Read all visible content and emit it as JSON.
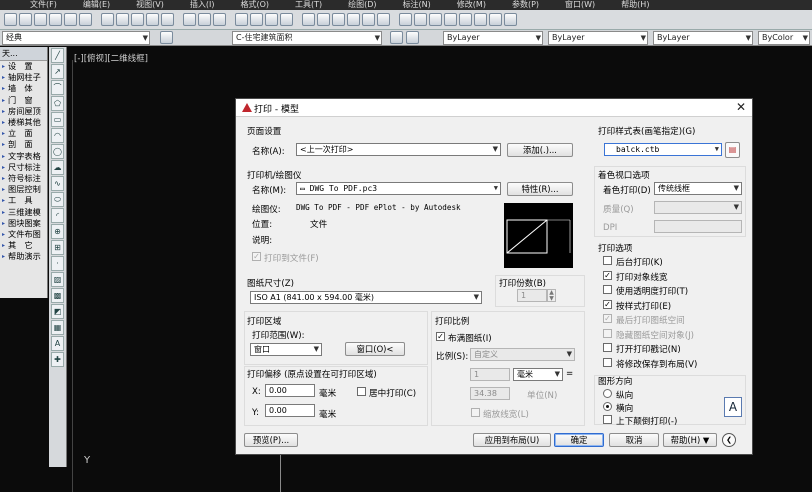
{
  "menubar": [
    "文件(F)",
    "编辑(E)",
    "视图(V)",
    "插入(I)",
    "格式(O)",
    "工具(T)",
    "绘图(D)",
    "标注(N)",
    "修改(M)",
    "参数(P)",
    "窗口(W)",
    "帮助(H)"
  ],
  "toolbar2": {
    "workspace": "经典",
    "layer": "C-住宅建筑面积",
    "color": "ByLayer",
    "linetype": "ByLayer",
    "lineweight": "ByLayer",
    "plotstyle": "ByColor"
  },
  "palette": {
    "header": "天...",
    "items": [
      "设　置",
      "轴网柱子",
      "墙　体",
      "门　窗",
      "房间屋顶",
      "楼梯其他",
      "立　面",
      "剖　面",
      "文字表格",
      "尺寸标注",
      "符号标注",
      "图层控制",
      "工　具",
      "三维建模",
      "图块图案",
      "文件布图",
      "其　它",
      "帮助演示"
    ]
  },
  "viewport": {
    "label": "[-][俯视][二维线框]",
    "ucs_axis": "Y"
  },
  "dialog": {
    "title": "打印 - 模型",
    "page_setup": {
      "section": "页面设置",
      "name_label": "名称(A):",
      "name_value": "<上一次打印>",
      "add_button": "添加(.)..."
    },
    "printer": {
      "section": "打印机/绘图仪",
      "name_label": "名称(M):",
      "name_value": "DWG To PDF.pc3",
      "properties_button": "特性(R)...",
      "plotter_label": "绘图仪:",
      "plotter_value": "DWG To PDF - PDF ePlot - by Autodesk",
      "location_label": "位置:",
      "location_value": "文件",
      "description_label": "说明:",
      "plot_to_file": "打印到文件(F)"
    },
    "paper_size": {
      "section": "图纸尺寸(Z)",
      "value": "ISO A1 (841.00 x 594.00 毫米)"
    },
    "copies": {
      "section": "打印份数(B)",
      "value": "1"
    },
    "plot_area": {
      "section": "打印区域",
      "range_label": "打印范围(W):",
      "range_value": "窗口",
      "window_button": "窗口(O)<"
    },
    "plot_offset": {
      "section": "打印偏移 (原点设置在可打印区域)",
      "x_label": "X:",
      "x_value": "0.00",
      "x_unit": "毫米",
      "y_label": "Y:",
      "y_value": "0.00",
      "y_unit": "毫米",
      "center_label": "居中打印(C)"
    },
    "plot_scale": {
      "section": "打印比例",
      "fit_label": "布满图纸(I)",
      "scale_label": "比例(S):",
      "scale_value": "自定义",
      "num_value": "1",
      "unit_value": "毫米",
      "eq": "=",
      "den_value": "34.38",
      "den_unit": "单位(N)",
      "lineweights": "缩放线宽(L)"
    },
    "plot_style_table": {
      "section": "打印样式表(画笔指定)(G)",
      "value": "balck.ctb"
    },
    "shaded_viewport": {
      "section": "着色视口选项",
      "shade_label": "着色打印(D)",
      "shade_value": "传统线框",
      "quality_label": "质量(Q)",
      "dpi_label": "DPI"
    },
    "plot_options": {
      "section": "打印选项",
      "items": [
        {
          "label": "后台打印(K)",
          "checked": false,
          "disabled": false
        },
        {
          "label": "打印对象线宽",
          "checked": true,
          "disabled": false
        },
        {
          "label": "使用透明度打印(T)",
          "checked": false,
          "disabled": false
        },
        {
          "label": "按样式打印(E)",
          "checked": true,
          "disabled": false
        },
        {
          "label": "最后打印图纸空间",
          "checked": true,
          "disabled": true
        },
        {
          "label": "隐藏图纸空间对象(J)",
          "checked": false,
          "disabled": true
        },
        {
          "label": "打开打印戳记(N)",
          "checked": false,
          "disabled": false
        },
        {
          "label": "将修改保存到布局(V)",
          "checked": false,
          "disabled": false
        }
      ]
    },
    "orientation": {
      "section": "图形方向",
      "portrait": "纵向",
      "landscape": "横向",
      "upside_down": "上下颠倒打印(-)",
      "icon_letter": "A"
    },
    "buttons": {
      "preview": "预览(P)...",
      "apply": "应用到布局(U)",
      "ok": "确定",
      "cancel": "取消",
      "help": "帮助(H)"
    }
  }
}
